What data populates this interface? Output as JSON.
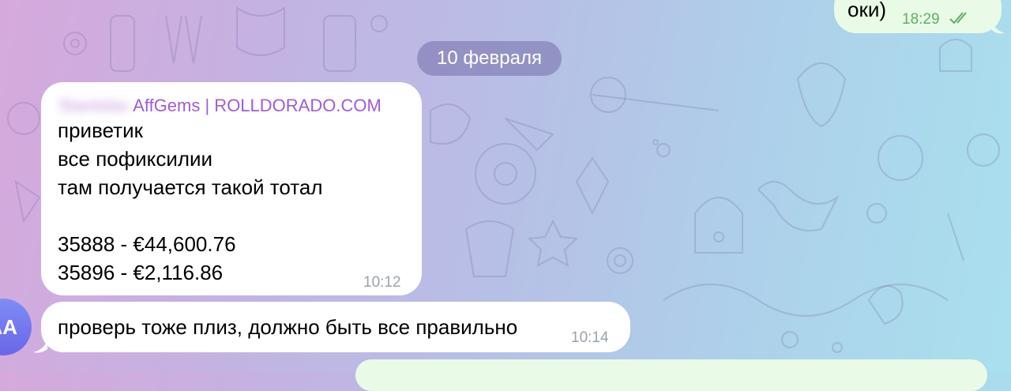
{
  "chat": {
    "top_message": {
      "text": "оки)",
      "time": "18:29",
      "status": "read-double-check-icon"
    },
    "date_separator": "10 февраля",
    "messages": [
      {
        "sender_blurred": "Stanislav",
        "sender": "AffGems | ROLLDORADO.COM",
        "lines": [
          "приветик",
          "все пофиксилии",
          "там получается такой тотал",
          "",
          "35888 - €44,600.76",
          "35896 - €2,116.86"
        ],
        "time": "10:12"
      },
      {
        "text": "проверь тоже плиз, должно быть все правильно",
        "time": "10:14"
      }
    ],
    "avatar_initials": "AA"
  },
  "colors": {
    "incoming_bubble": "#ffffff",
    "outgoing_bubble": "#e9fbe7",
    "sender_name": "#a05bd6",
    "avatar": "#6f72ee"
  }
}
